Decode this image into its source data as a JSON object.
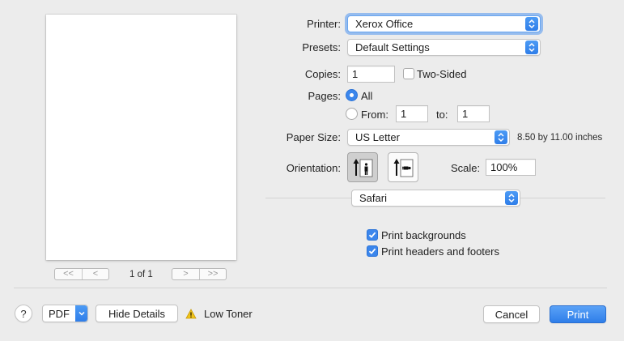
{
  "preview": {
    "page_indicator": "1 of 1",
    "first_glyph": "<<",
    "prev_glyph": "<",
    "next_glyph": ">",
    "last_glyph": ">>"
  },
  "printer": {
    "label": "Printer:",
    "value": "Xerox Office"
  },
  "presets": {
    "label": "Presets:",
    "value": "Default Settings"
  },
  "copies": {
    "label": "Copies:",
    "value": "1",
    "two_sided_label": "Two-Sided",
    "two_sided_checked": false
  },
  "pages": {
    "label": "Pages:",
    "all_label": "All",
    "from_label": "From:",
    "from_value": "1",
    "to_label": "to:",
    "to_value": "1",
    "selected": "all"
  },
  "paper_size": {
    "label": "Paper Size:",
    "value": "US Letter",
    "dimensions": "8.50 by 11.00 inches"
  },
  "orientation": {
    "label": "Orientation:",
    "selected": "portrait"
  },
  "scale": {
    "label": "Scale:",
    "value": "100%"
  },
  "app_section": {
    "value": "Safari"
  },
  "options": {
    "print_backgrounds_label": "Print backgrounds",
    "print_backgrounds_checked": true,
    "print_headers_footers_label": "Print headers and footers",
    "print_headers_footers_checked": true
  },
  "footer": {
    "help_glyph": "?",
    "pdf_label": "PDF",
    "hide_details_label": "Hide Details",
    "warning_label": "Low Toner",
    "cancel_label": "Cancel",
    "print_label": "Print"
  },
  "colors": {
    "accent": "#3b86ec",
    "warning": "#f0c419",
    "background": "#ececec"
  }
}
